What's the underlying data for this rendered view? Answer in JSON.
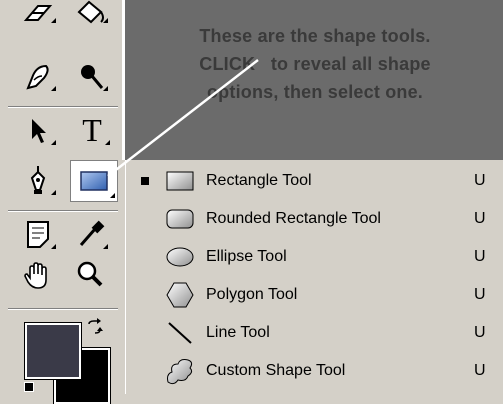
{
  "callout": {
    "line1": "These are the shape tools.",
    "line2": "CLICK   to reveal all shape",
    "line3": "options, then select one."
  },
  "toolbox": {
    "tools": [
      {
        "name": "eraser-tool",
        "icon": "eraser-icon"
      },
      {
        "name": "paint-bucket-tool",
        "icon": "paint-bucket-icon"
      },
      {
        "name": "smudge-tool",
        "icon": "smudge-icon"
      },
      {
        "name": "burn-tool",
        "icon": "burn-icon"
      },
      {
        "name": "path-selection-tool",
        "icon": "arrow-icon"
      },
      {
        "name": "type-tool",
        "icon": "type-icon",
        "label": "T"
      },
      {
        "name": "pen-tool",
        "icon": "pen-icon"
      },
      {
        "name": "shape-tool",
        "icon": "rectangle-icon"
      },
      {
        "name": "notes-tool",
        "icon": "notes-icon"
      },
      {
        "name": "eyedropper-tool",
        "icon": "eyedropper-icon"
      },
      {
        "name": "hand-tool",
        "icon": "hand-icon"
      },
      {
        "name": "zoom-tool",
        "icon": "zoom-icon"
      }
    ],
    "foreground_color": "#3a3a48",
    "background_color": "#000000"
  },
  "shape_menu": {
    "items": [
      {
        "label": "Rectangle Tool",
        "shortcut": "U",
        "icon": "rectangle-icon",
        "selected": true
      },
      {
        "label": "Rounded Rectangle Tool",
        "shortcut": "U",
        "icon": "rounded-rectangle-icon",
        "selected": false
      },
      {
        "label": "Ellipse Tool",
        "shortcut": "U",
        "icon": "ellipse-icon",
        "selected": false
      },
      {
        "label": "Polygon Tool",
        "shortcut": "U",
        "icon": "polygon-icon",
        "selected": false
      },
      {
        "label": "Line Tool",
        "shortcut": "U",
        "icon": "line-icon",
        "selected": false
      },
      {
        "label": "Custom Shape Tool",
        "shortcut": "U",
        "icon": "custom-shape-icon",
        "selected": false
      }
    ]
  },
  "colors": {
    "panel": "#d4d0c8",
    "callout_bg": "#6b6b6b",
    "callout_text": "#3a3a3a",
    "pointer_line": "#ffffff"
  }
}
